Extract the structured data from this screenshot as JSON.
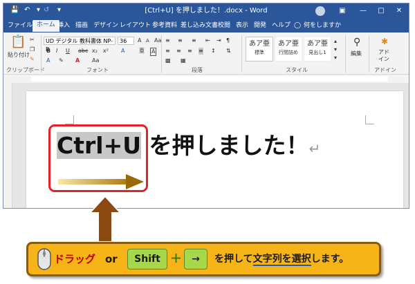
{
  "window": {
    "title": "[Ctrl+U] を押しました！.docx  -  Word"
  },
  "quick_access": {
    "save_icon": "save-icon",
    "undo_icon": "undo-icon",
    "redo_icon": "redo-icon",
    "more_icon": "dropdown-icon"
  },
  "ribbon_tabs": [
    "ファイル",
    "ホーム",
    "挿入",
    "描画",
    "デザイン",
    "レイアウト",
    "参考資料",
    "差し込み文書",
    "校閲",
    "表示",
    "開発",
    "ヘルプ"
  ],
  "active_tab": "ホーム",
  "tell_me": "何をしますか",
  "clipboard": {
    "paste_label": "貼り付け",
    "group_label": "クリップボード"
  },
  "font": {
    "name": "UD デジタル 教科書体 NP-B",
    "size": "36",
    "group_label": "フォント",
    "bold": "B",
    "italic": "I",
    "underline": "U",
    "strike": "abc",
    "subscript": "x₂",
    "superscript": "x²",
    "grow": "A",
    "shrink": "A",
    "case": "Aa",
    "clear": "A",
    "phonetic": "亜",
    "border": "A"
  },
  "paragraph": {
    "group_label": "段落"
  },
  "styles": {
    "group_label": "スタイル",
    "items": [
      {
        "preview": "あア亜",
        "name": "標準"
      },
      {
        "preview": "あア亜",
        "name": "行間詰め"
      },
      {
        "preview": "あア亜",
        "name": "見出し1"
      }
    ]
  },
  "editing": {
    "label": "編集"
  },
  "addins": {
    "label": "アド\nイン",
    "group_label": "アドイン"
  },
  "document": {
    "selected_text": "Ctrl+U",
    "rest_text": " を押しました！",
    "paragraph_mark": "↵"
  },
  "instruction": {
    "drag": "ドラッグ",
    "or": "or",
    "shift": "Shift",
    "plus": "＋",
    "arrow_key": "→",
    "text_pre": "を押して",
    "text_target": "文字列を選択",
    "text_post": "します。"
  },
  "colors": {
    "title_bar": "#2b579a",
    "selection_box": "#e8202a",
    "instruction_bg": "#f7b418",
    "instruction_text": "#c00000",
    "keycap": "#a7d84a"
  }
}
